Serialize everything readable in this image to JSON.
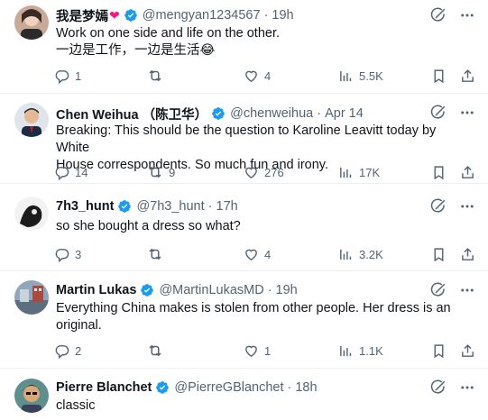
{
  "tweets": [
    {
      "name": "我是梦嫣",
      "handle": "@mengyan1234567",
      "sep": "·",
      "time": "19h",
      "lines": [
        "Work on one side and life on the other.",
        "一边是工作，一边是生活😂"
      ],
      "replies": "1",
      "reposts": "",
      "likes": "4",
      "views": "5.5K"
    },
    {
      "name": "Chen Weihua （陈卫华）",
      "handle": "@chenweihua",
      "sep": "·",
      "time": "Apr 14",
      "lines": [
        "Breaking: This should be the question to Karoline Leavitt today by White",
        "House correspondents. So much fun and irony."
      ],
      "replies": "14",
      "reposts": "9",
      "likes": "276",
      "views": "17K"
    },
    {
      "name": "7h3_hunt",
      "handle": "@7h3_hunt",
      "sep": "·",
      "time": "17h",
      "lines": [
        "so she bought a dress so what?"
      ],
      "replies": "3",
      "reposts": "",
      "likes": "4",
      "views": "3.2K"
    },
    {
      "name": "Martin Lukas",
      "handle": "@MartinLukasMD",
      "sep": "·",
      "time": "19h",
      "lines": [
        "Everything China makes is stolen from other people. Her dress is an",
        "original."
      ],
      "replies": "2",
      "reposts": "",
      "likes": "1",
      "views": "1.1K"
    },
    {
      "name": "Pierre Blanchet",
      "handle": "@PierreGBlanchet",
      "sep": "·",
      "time": "18h",
      "lines": [
        "classic"
      ],
      "replies": "",
      "reposts": "",
      "likes": "",
      "views": ""
    }
  ],
  "colors": {
    "verified": "#1d9bf0",
    "secondary_text": "#536471",
    "primary_text": "#0f1419",
    "divider": "#eff3f4",
    "heart": "#f91880"
  },
  "icons": [
    "verified-badge-icon",
    "heart-emoji-icon",
    "grok-icon",
    "more-icon",
    "reply-icon",
    "repost-icon",
    "like-icon",
    "views-icon",
    "bookmark-icon",
    "share-icon"
  ]
}
